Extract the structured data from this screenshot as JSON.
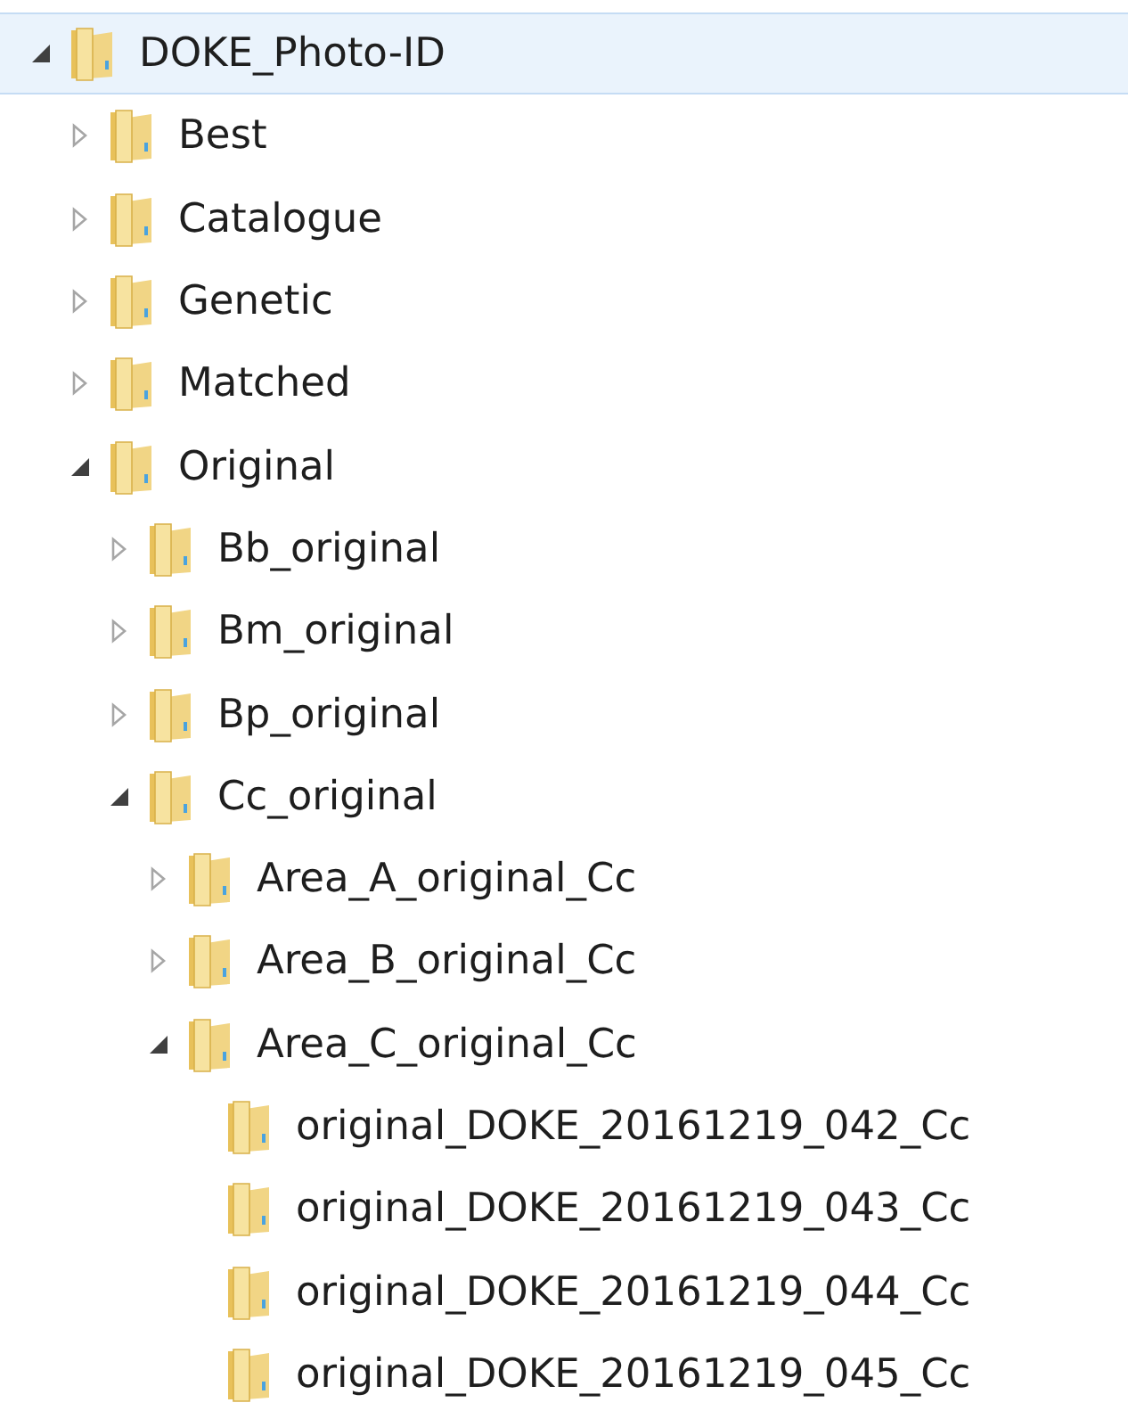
{
  "tree": [
    {
      "label": "DOKE_Photo-ID",
      "kind": "branch",
      "expanded": true,
      "selected": true,
      "children": [
        {
          "label": "Best",
          "kind": "branch",
          "expanded": false,
          "selected": false
        },
        {
          "label": "Catalogue",
          "kind": "branch",
          "expanded": false,
          "selected": false
        },
        {
          "label": "Genetic",
          "kind": "branch",
          "expanded": false,
          "selected": false
        },
        {
          "label": "Matched",
          "kind": "branch",
          "expanded": false,
          "selected": false
        },
        {
          "label": "Original",
          "kind": "branch",
          "expanded": true,
          "selected": false,
          "children": [
            {
              "label": "Bb_original",
              "kind": "branch",
              "expanded": false,
              "selected": false
            },
            {
              "label": "Bm_original",
              "kind": "branch",
              "expanded": false,
              "selected": false
            },
            {
              "label": "Bp_original",
              "kind": "branch",
              "expanded": false,
              "selected": false
            },
            {
              "label": "Cc_original",
              "kind": "branch",
              "expanded": true,
              "selected": false,
              "children": [
                {
                  "label": "Area_A_original_Cc",
                  "kind": "branch",
                  "expanded": false,
                  "selected": false
                },
                {
                  "label": "Area_B_original_Cc",
                  "kind": "branch",
                  "expanded": false,
                  "selected": false
                },
                {
                  "label": "Area_C_original_Cc",
                  "kind": "branch",
                  "expanded": true,
                  "selected": false,
                  "children": [
                    {
                      "label": "original_DOKE_20161219_042_Cc",
                      "kind": "leaf",
                      "selected": false
                    },
                    {
                      "label": "original_DOKE_20161219_043_Cc",
                      "kind": "leaf",
                      "selected": false
                    },
                    {
                      "label": "original_DOKE_20161219_044_Cc",
                      "kind": "leaf",
                      "selected": false
                    },
                    {
                      "label": "original_DOKE_20161219_045_Cc",
                      "kind": "leaf",
                      "selected": false
                    }
                  ]
                }
              ]
            }
          ]
        }
      ]
    }
  ]
}
